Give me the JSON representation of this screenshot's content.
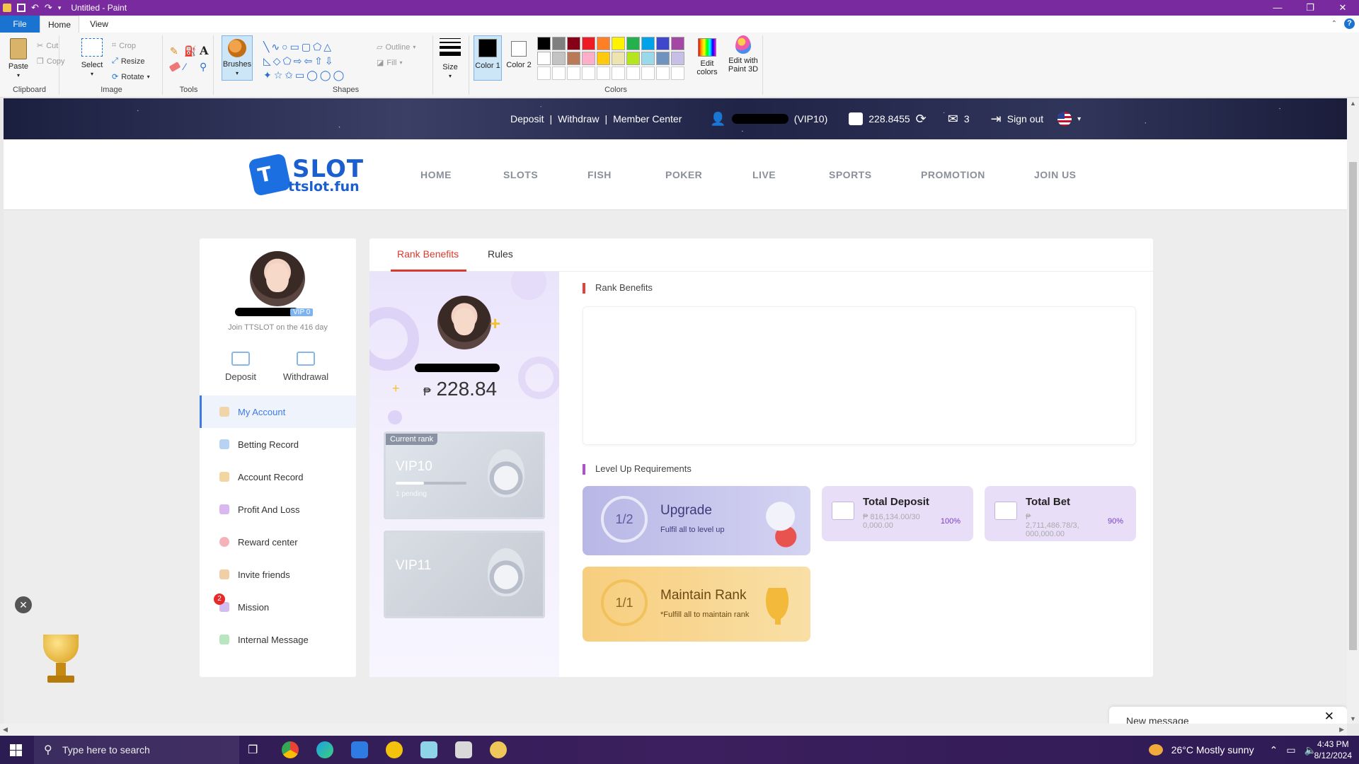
{
  "paint": {
    "title": "Untitled - Paint",
    "tabs": [
      "File",
      "Home",
      "View"
    ],
    "clipboard": {
      "paste": "Paste",
      "cut": "Cut",
      "copy": "Copy",
      "group": "Clipboard"
    },
    "image": {
      "select": "Select",
      "crop": "Crop",
      "resize": "Resize",
      "rotate": "Rotate",
      "group": "Image"
    },
    "tools": {
      "group": "Tools",
      "brushes": "Brushes"
    },
    "shapes": {
      "outline": "Outline",
      "fill": "Fill",
      "group": "Shapes"
    },
    "size": "Size",
    "color1": "Color 1",
    "color2": "Color 2",
    "colors_group": "Colors",
    "edit_colors": "Edit colors",
    "edit_paint3d": "Edit with Paint 3D",
    "palette_row1": [
      "#000000",
      "#7f7f7f",
      "#880015",
      "#ed1c24",
      "#ff7f27",
      "#fff200",
      "#22b14c",
      "#00a2e8",
      "#3f48cc",
      "#a349a4"
    ],
    "palette_row2": [
      "#ffffff",
      "#c3c3c3",
      "#b97a57",
      "#ffaec9",
      "#ffc90e",
      "#efe4b0",
      "#b5e61d",
      "#99d9ea",
      "#7092be",
      "#c8bfe7"
    ]
  },
  "site": {
    "top": {
      "deposit": "Deposit",
      "withdraw": "Withdraw",
      "member_center": "Member Center",
      "vip": "(VIP10)",
      "balance": "228.8455",
      "mail_count": "3",
      "sign_out": "Sign out"
    },
    "logo": {
      "word1": "SLOT",
      "word2": "ttslot.fun"
    },
    "menu": [
      "HOME",
      "SLOTS",
      "FISH",
      "POKER",
      "LIVE",
      "SPORTS",
      "PROMOTION",
      "JOIN US"
    ],
    "left": {
      "vip_badge": "VIP 0",
      "join": "Join TTSLOT on the 416 day",
      "deposit": "Deposit",
      "withdrawal": "Withdrawal",
      "items": [
        "My Account",
        "Betting Record",
        "Account Record",
        "Profit And Loss",
        "Reward center",
        "Invite friends",
        "Mission",
        "Internal Message"
      ],
      "mission_badge": "2"
    },
    "main": {
      "tabs": [
        "Rank Benefits",
        "Rules"
      ],
      "currency": "₱",
      "balance": "228.84",
      "current_rank_label": "Current rank",
      "current_vip": "VIP10",
      "pending": "1 pending",
      "current_progress": 0.4,
      "next_vip": "VIP11",
      "rank_benefits_title": "Rank Benefits",
      "level_up_title": "Level Up Requirements",
      "upgrade": {
        "ring": "1/2",
        "title": "Upgrade",
        "sub": "Fulfil all to level up"
      },
      "maintain": {
        "ring": "1/1",
        "title": "Maintain Rank",
        "sub": "*Fulfill all to maintain rank"
      },
      "total_deposit": {
        "title": "Total Deposit",
        "value": "₱ 816,134.00/30 0,000.00",
        "percent": "100%"
      },
      "total_bet": {
        "title": "Total Bet",
        "value": "₱ 2,711,486.78/3, 000,000.00",
        "percent": "90%"
      }
    },
    "new_message": "New message"
  },
  "taskbar": {
    "search": "Type here to search",
    "weather": "26°C  Mostly sunny",
    "time": "4:43 PM",
    "date": "8/12/2024"
  }
}
